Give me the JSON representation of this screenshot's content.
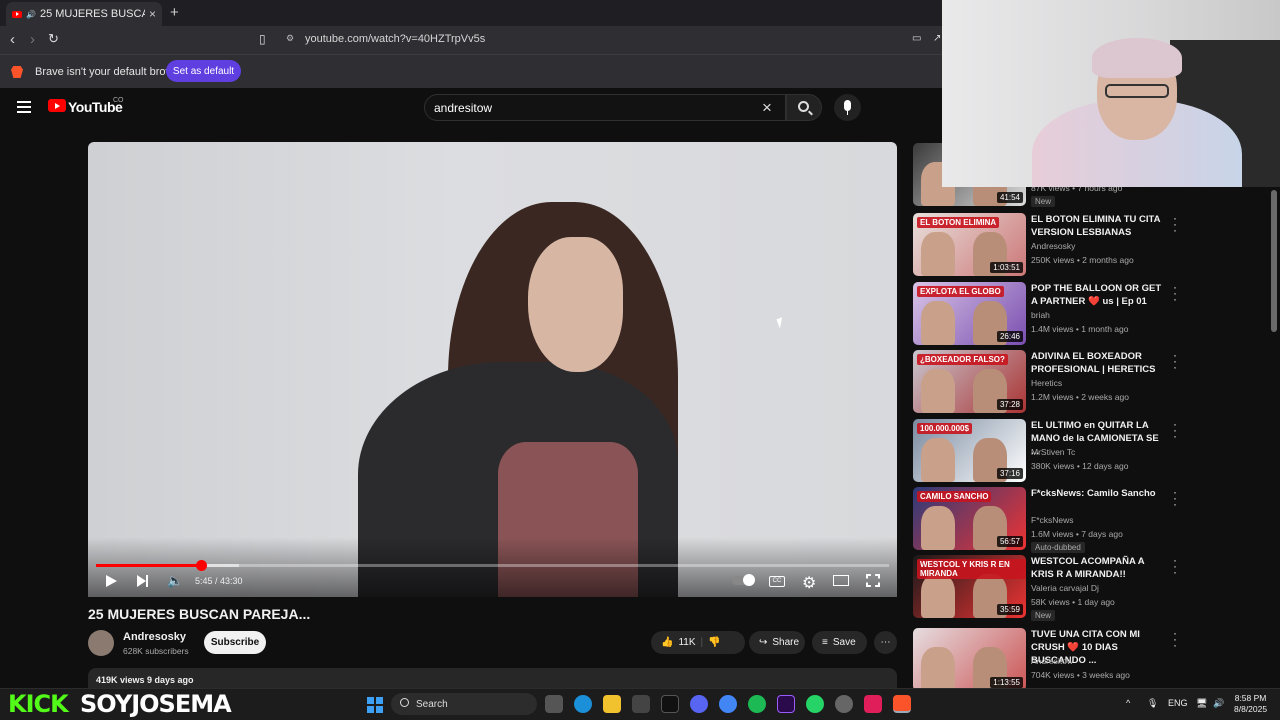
{
  "browser": {
    "tab_title": "25 MUJERES BUSCAN PAREJA...",
    "tab_close": "×",
    "new_tab": "+",
    "url": "youtube.com/watch?v=40HZTrpVv5s",
    "infobar_text": "Brave isn't your default browser",
    "set_default_label": "Set as default"
  },
  "youtube": {
    "logo_text": "YouTube",
    "country_code": "CO",
    "search_value": "andresitow",
    "clear_icon": "×"
  },
  "player": {
    "current_time": "5:45",
    "duration": "43:30",
    "time_display": "5:45 / 43:30",
    "progress_fraction": 0.132,
    "buffered_fraction": 0.18,
    "cc_label": "CC"
  },
  "video": {
    "title": "25 MUJERES BUSCAN PAREJA...",
    "channel": "Andresosky",
    "subscribers": "628K subscribers",
    "subscribe_label": "Subscribe",
    "likes": "11K",
    "share_label": "Share",
    "save_label": "Save",
    "views_date": "419K views  9 days ago"
  },
  "recommendations": [
    {
      "title": "",
      "channel": "",
      "meta": "87K views • 7 hours ago",
      "duration": "41:54",
      "badge": "New",
      "caption": ""
    },
    {
      "title": "EL BOTON ELIMINA TU CITA VERSION LESBIANAS",
      "channel": "Andresosky",
      "meta": "250K views • 2 months ago",
      "duration": "1:03:51",
      "badge": "",
      "caption": "EL BOTON ELIMINA"
    },
    {
      "title": "POP THE BALLOON OR GET A PARTNER ❤️ us | Ep 01",
      "channel": "briah",
      "meta": "1.4M views • 1 month ago",
      "duration": "26:46",
      "badge": "",
      "caption": "EXPLOTA EL GLOBO"
    },
    {
      "title": "ADIVINA EL BOXEADOR PROFESIONAL | HERETICS",
      "channel": "Heretics",
      "meta": "1.2M views • 2 weeks ago",
      "duration": "37:28",
      "badge": "",
      "caption": "¿BOXEADOR FALSO?"
    },
    {
      "title": "EL ULTIMO en QUITAR LA MANO de la CAMIONETA SE ...",
      "channel": "MrStiven Tc",
      "meta": "380K views • 12 days ago",
      "duration": "37:16",
      "badge": "",
      "caption": "100.000.000$"
    },
    {
      "title": "F*cksNews: Camilo Sancho",
      "channel": "F*cksNews",
      "meta": "1.6M views • 7 days ago",
      "duration": "56:57",
      "badge": "Auto-dubbed",
      "caption": "CAMILO SANCHO"
    },
    {
      "title": "WESTCOL ACOMPAÑA A KRIS R A MIRANDA!!",
      "channel": "Valeria carvajal Dj",
      "meta": "58K views • 1 day ago",
      "duration": "35:59",
      "badge": "New",
      "caption": "WESTCOL Y KRIS R EN MIRANDA"
    },
    {
      "title": "TUVE UNA CITA CON MI CRUSH ❤️ 10 DIAS BUSCANDO ...",
      "channel": "Andresitow",
      "meta": "704K views • 3 weeks ago",
      "duration": "1:13:55",
      "badge": "",
      "caption": ""
    }
  ],
  "overlay": {
    "kick_text": "KICK",
    "streamer_name": "SOYJOSEMA"
  },
  "taskbar": {
    "search_label": "Search",
    "language": "ENG",
    "time": "8:58 PM",
    "date": "8/8/2025"
  },
  "colors": {
    "accent_red": "#ff0000",
    "kick_green": "#53fc18",
    "brave_purple": "#5f3fe0"
  }
}
